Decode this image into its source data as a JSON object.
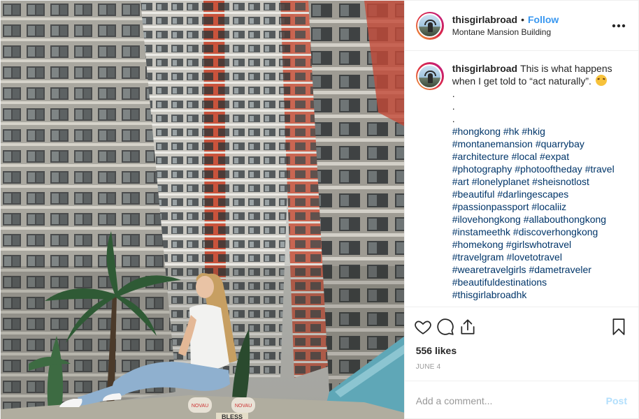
{
  "header": {
    "username": "thisgirlabroad",
    "separator": "•",
    "follow_label": "Follow",
    "location": "Montane Mansion Building",
    "more_icon": "more-options-icon"
  },
  "caption": {
    "username": "thisgirlabroad",
    "text": "This is what happens when I get told to “act naturally”.",
    "emoji": "grinning-squinting-face",
    "dots": [
      ".",
      ".",
      "."
    ],
    "hashtags": [
      "#hongkong",
      "#hk",
      "#hkig",
      "#montanemansion",
      "#quarrybay",
      "#architecture",
      "#local",
      "#expat",
      "#photography",
      "#photooftheday",
      "#travel",
      "#art",
      "#lonelyplanet",
      "#sheisnotlost",
      "#beautiful",
      "#darlingescapes",
      "#passionpassport",
      "#localiiz",
      "#ilovehongkong",
      "#allabouthongkong",
      "#instameethk",
      "#discoverhongkong",
      "#homekong",
      "#girlswhotravel",
      "#travelgram",
      "#lovetotravel",
      "#wearetravelgirls",
      "#dametraveler",
      "#beautifuldestinations",
      "#thisgirlabroadhk"
    ]
  },
  "actions": {
    "icons": [
      "heart-icon",
      "comment-icon",
      "share-icon",
      "bookmark-icon"
    ],
    "likes": "556 likes",
    "date": "JUNE 4"
  },
  "add_comment": {
    "placeholder": "Add a comment...",
    "post_label": "Post"
  },
  "photo": {
    "sign_text_1": "NOVAU",
    "sign_text_2": "NOVAU",
    "sign_text_3": "BLESS"
  },
  "colors": {
    "accent": "#3897f0",
    "hashtag": "#003569",
    "muted": "#999999",
    "post_disabled": "#b2dffc",
    "story_ring": "#dc2743"
  }
}
